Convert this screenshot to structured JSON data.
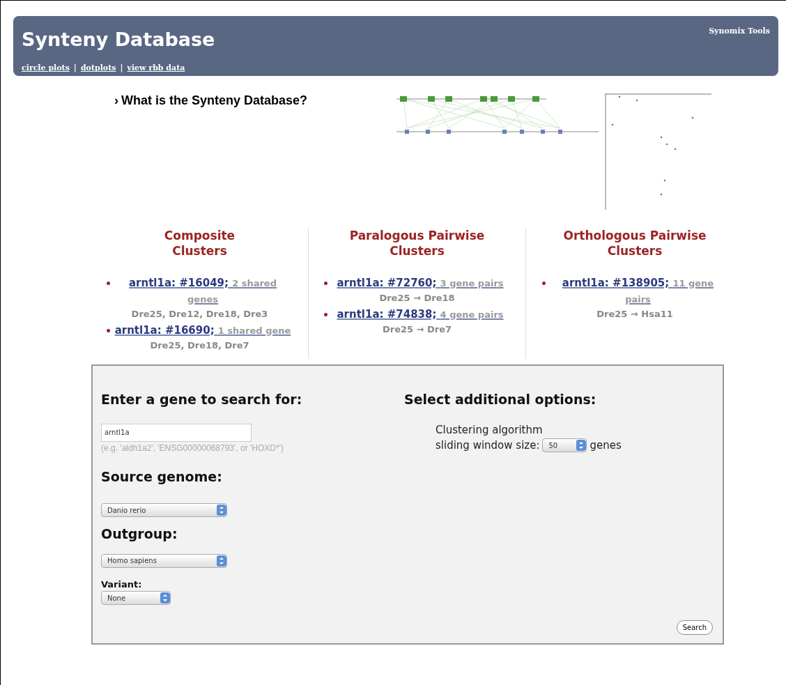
{
  "header": {
    "title": "Synteny Database",
    "tools_link": "Synomix Tools",
    "nav": [
      {
        "label": "circle plots"
      },
      {
        "label": "dotplots"
      },
      {
        "label": "view rbb data"
      }
    ],
    "separator": "|"
  },
  "intro": {
    "marker": "›",
    "link": "What is the Synteny Database?"
  },
  "columns": [
    {
      "title": "Composite Clusters",
      "results": [
        {
          "link": "arntl1a: #16049;",
          "count": "2 shared genes",
          "chromosomes": "Dre25, Dre12, Dre18, Dre3"
        },
        {
          "link": "arntl1a: #16690;",
          "count": "1 shared gene",
          "chromosomes": "Dre25, Dre18, Dre7"
        }
      ]
    },
    {
      "title": "Paralogous Pairwise Clusters",
      "results": [
        {
          "link": "arntl1a: #72760;",
          "count": "3 gene pairs",
          "chromosomes": "Dre25 → Dre18"
        },
        {
          "link": "arntl1a: #74838;",
          "count": "4 gene pairs",
          "chromosomes": "Dre25 → Dre7"
        }
      ]
    },
    {
      "title": "Orthologous Pairwise Clusters",
      "results": [
        {
          "link": "arntl1a: #138905;",
          "count": "11 gene pairs",
          "chromosomes": "Dre25 → Hsa11"
        }
      ]
    }
  ],
  "form": {
    "gene_heading": "Enter a gene to search for:",
    "gene_value": "arntl1a",
    "gene_hint": "(e.g. 'aldh1a2', 'ENSG00000068793', or 'HOXD*')",
    "source_heading": "Source genome:",
    "source_value": "Danio rerio",
    "outgroup_heading": "Outgroup:",
    "outgroup_value": "Homo sapiens",
    "variant_label": "Variant:",
    "variant_value": "None",
    "options_heading": "Select additional options:",
    "window_label_1": "Clustering algorithm",
    "window_label_2": "sliding window size:",
    "window_value": "50",
    "window_unit": "genes",
    "search_button": "Search"
  }
}
